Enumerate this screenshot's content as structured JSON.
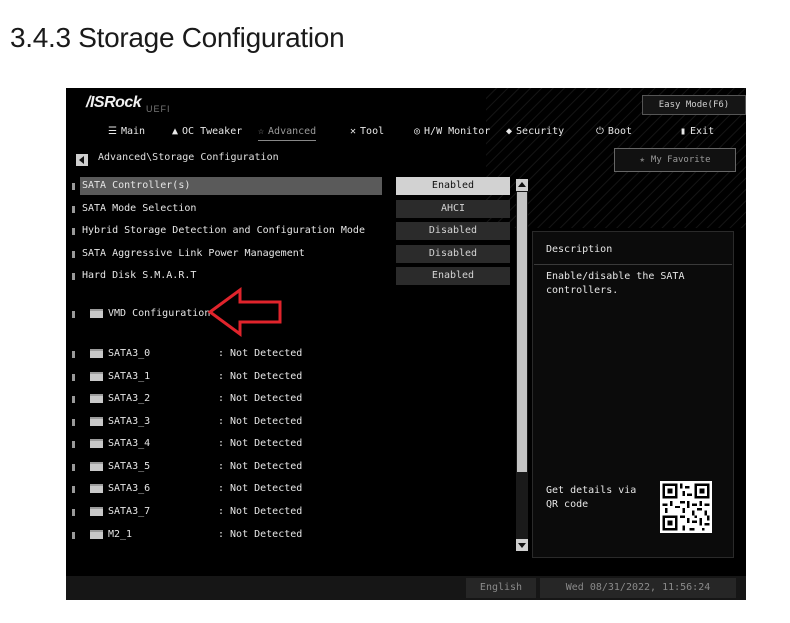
{
  "document": {
    "heading": "3.4.3 Storage Configuration"
  },
  "header": {
    "logo": "/ISRock",
    "logo_sub": "UEFI",
    "easy_mode": "Easy Mode(F6)"
  },
  "nav": [
    {
      "label": "Main",
      "icon": "list-icon",
      "glyph": "☰"
    },
    {
      "label": "OC Tweaker",
      "icon": "rocket-icon",
      "glyph": "▲"
    },
    {
      "label": "Advanced",
      "icon": "star-icon",
      "glyph": "☆"
    },
    {
      "label": "Tool",
      "icon": "tools-icon",
      "glyph": "✕"
    },
    {
      "label": "H/W Monitor",
      "icon": "monitor-icon",
      "glyph": "◎"
    },
    {
      "label": "Security",
      "icon": "shield-icon",
      "glyph": "◆"
    },
    {
      "label": "Boot",
      "icon": "power-icon",
      "glyph": "⏻"
    },
    {
      "label": "Exit",
      "icon": "exit-icon",
      "glyph": "▮"
    }
  ],
  "breadcrumb": "Advanced\\Storage Configuration",
  "favorite": {
    "label": "My Favorite",
    "glyph": "★"
  },
  "settings": [
    {
      "label": "SATA Controller(s)",
      "value": "Enabled"
    },
    {
      "label": "SATA Mode Selection",
      "value": "AHCI"
    },
    {
      "label": "Hybrid Storage Detection and Configuration Mode",
      "value": "Disabled"
    },
    {
      "label": "SATA Aggressive Link Power Management",
      "value": "Disabled"
    },
    {
      "label": "Hard Disk S.M.A.R.T",
      "value": "Enabled"
    }
  ],
  "vmd": {
    "label": "VMD Configuration"
  },
  "ports": [
    {
      "name": "SATA3_0",
      "status": ": Not Detected"
    },
    {
      "name": "SATA3_1",
      "status": ": Not Detected"
    },
    {
      "name": "SATA3_2",
      "status": ": Not Detected"
    },
    {
      "name": "SATA3_3",
      "status": ": Not Detected"
    },
    {
      "name": "SATA3_4",
      "status": ": Not Detected"
    },
    {
      "name": "SATA3_5",
      "status": ": Not Detected"
    },
    {
      "name": "SATA3_6",
      "status": ": Not Detected"
    },
    {
      "name": "SATA3_7",
      "status": ": Not Detected"
    },
    {
      "name": "M2_1",
      "status": ": Not Detected"
    }
  ],
  "description": {
    "title": "Description",
    "text": "Enable/disable the SATA controllers.",
    "qr_text": "Get details via QR code"
  },
  "footer": {
    "language": "English",
    "datetime": "Wed 08/31/2022, 11:56:24"
  },
  "colors": {
    "annotation_arrow": "#e0242c",
    "selected_value_bg": "#d2d2d2"
  }
}
